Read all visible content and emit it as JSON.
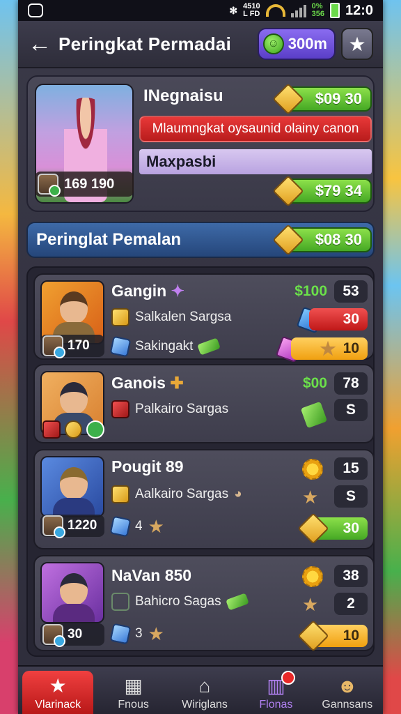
{
  "status_bar": {
    "network_text": "4510\nL FD",
    "carrier_text": "0%\n356",
    "time": "12:0"
  },
  "header": {
    "title": "Peringkat Permadai",
    "currency_value": "300m"
  },
  "profile": {
    "name": "INegnaisu",
    "top_money": "$09 30",
    "red_banner": "Mlaumngkat oysaunid olainy canon",
    "purple_bar": "Maxpasbi",
    "bottom_money": "$79 34",
    "portrait_stat": "169 190"
  },
  "section": {
    "title": "Peringlat Pemalan",
    "money": "$08 30"
  },
  "players": [
    {
      "name": "Gangin",
      "sub1": "Salkalen Sargsa",
      "sub2": "Sakingakt",
      "stat": "170",
      "right_label": "$100",
      "right_top": "53",
      "right_mid": "30",
      "right_bottom": "10"
    },
    {
      "name": "Ganois",
      "sub1": "Palkairo Sargas",
      "right_label": "$00",
      "right_top": "78",
      "right_mid": "S"
    },
    {
      "name": "Pougit 89",
      "sub1": "Aalkairo Sargas",
      "sub2": "4",
      "stat": "1220",
      "right_top": "15",
      "right_mid": "S",
      "right_bottom": "30"
    },
    {
      "name": "NaVan 850",
      "sub1": "Bahicro Sagas",
      "sub2": "3",
      "stat": "30",
      "right_top": "38",
      "right_mid": "2",
      "right_bottom": "10"
    }
  ],
  "bottom_nav": {
    "items": [
      {
        "label": "Vlarinack",
        "icon": "star-icon"
      },
      {
        "label": "Fnous",
        "icon": "building-icon"
      },
      {
        "label": "Wiriglans",
        "icon": "house-icon"
      },
      {
        "label": "Flonas",
        "icon": "chart-icon"
      },
      {
        "label": "Gannsans",
        "icon": "profile-icon"
      }
    ]
  },
  "colors": {
    "accent_green": "#45a824",
    "accent_red": "#d82828",
    "accent_purple": "#6a4ed8",
    "section_blue": "#2e5590"
  }
}
